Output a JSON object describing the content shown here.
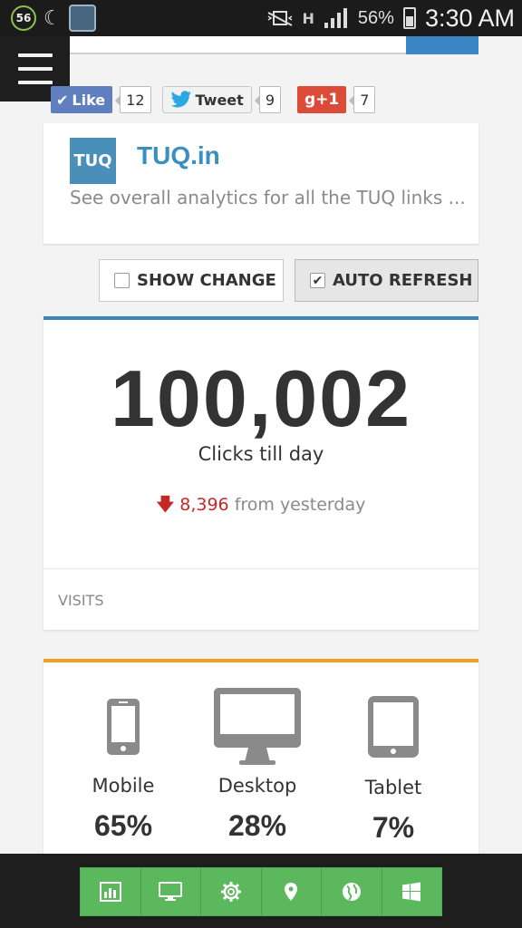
{
  "status_bar": {
    "notification_count": "56",
    "battery": "56%",
    "time": "3:30 AM",
    "network": "H"
  },
  "share": {
    "like_label": "Like",
    "like_count": "12",
    "tweet_label": "Tweet",
    "tweet_count": "9",
    "gplus_label": "g+1",
    "gplus_count": "7"
  },
  "site": {
    "logo_text": "TUQ",
    "name": "TUQ.in",
    "description": "See overall analytics for all the TUQ links ..."
  },
  "toggles": {
    "show_change": {
      "label": "SHOW CHANGE",
      "checked": false
    },
    "auto_refresh": {
      "label": "AUTO REFRESH",
      "checked": true
    }
  },
  "clicks": {
    "total": "100,002",
    "label": "Clicks till day",
    "change_value": "8,396",
    "change_suffix": "from yesterday",
    "direction": "down",
    "section_label": "VISITS"
  },
  "devices": [
    {
      "label": "Mobile",
      "percent": "65%"
    },
    {
      "label": "Desktop",
      "percent": "28%"
    },
    {
      "label": "Tablet",
      "percent": "7%"
    }
  ],
  "bottom_nav": [
    "bar-chart-icon",
    "desktop-icon",
    "gear-icon",
    "map-marker-icon",
    "globe-icon",
    "windows-icon"
  ],
  "colors": {
    "accent_blue": "#3c86b6",
    "accent_orange": "#f0a020",
    "nav_green": "#5cb85c",
    "decrease_red": "#c62828"
  }
}
